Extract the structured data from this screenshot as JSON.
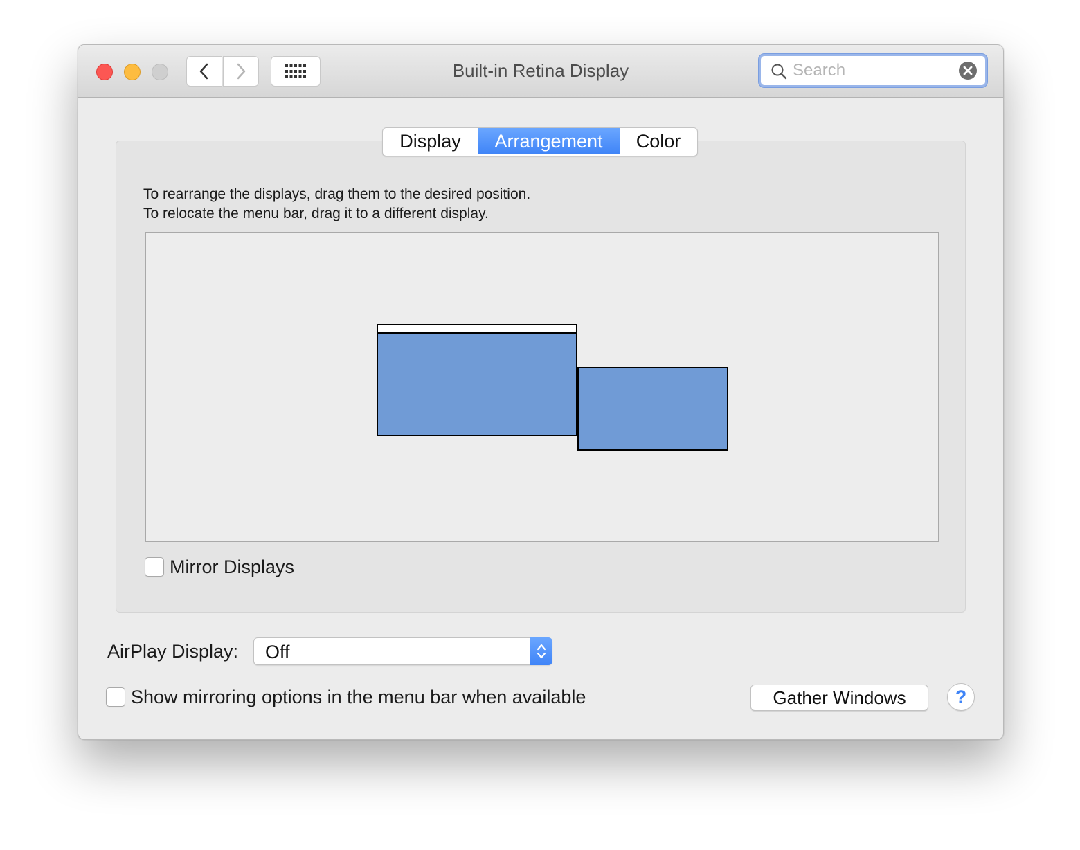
{
  "window": {
    "title": "Built-in Retina Display",
    "search": {
      "placeholder": "Search",
      "value": ""
    }
  },
  "tabs": [
    {
      "label": "Display",
      "selected": false
    },
    {
      "label": "Arrangement",
      "selected": true
    },
    {
      "label": "Color",
      "selected": false
    }
  ],
  "arrangement": {
    "instruction_1": "To rearrange the displays, drag them to the desired position.",
    "instruction_2": "To relocate the menu bar, drag it to a different display.",
    "display_color": "#709bd6"
  },
  "mirror": {
    "label": "Mirror Displays",
    "checked": false
  },
  "airplay": {
    "label": "AirPlay Display:",
    "value": "Off"
  },
  "show_mirroring": {
    "label": "Show mirroring options in the menu bar when available",
    "checked": false
  },
  "buttons": {
    "gather": "Gather Windows",
    "help": "?"
  },
  "colors": {
    "accent": "#3f84f7",
    "close": "#fc5753",
    "minimize": "#fdbc40",
    "zoom": "#cfcfcf"
  }
}
